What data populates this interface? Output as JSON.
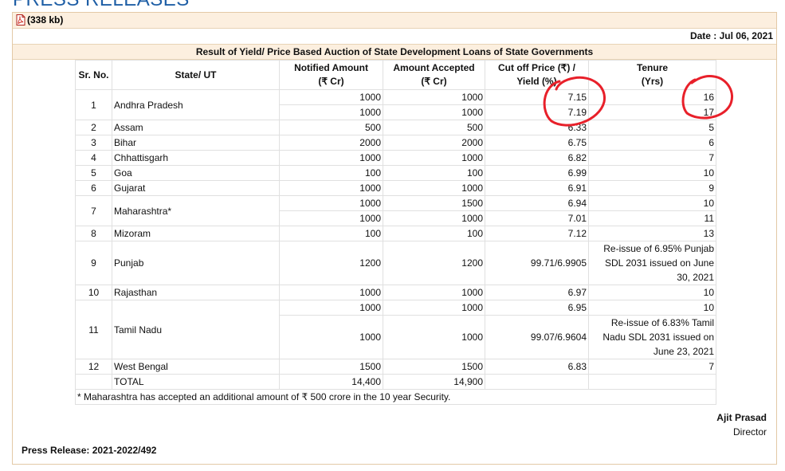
{
  "page": {
    "heading": "PRESS RELEASES"
  },
  "file": {
    "size_label": "(338 kb)",
    "icon": "pdf-icon"
  },
  "release": {
    "date": "Date : Jul 06, 2021",
    "title": "Result of Yield/ Price Based Auction of State Development Loans of State Governments",
    "press_release_no": "Press Release: 2021-2022/492",
    "signatory_name": "Ajit Prasad",
    "signatory_title": "Director",
    "footnote": "* Maharashtra has accepted an additional amount of ₹ 500 crore in the 10 year Security."
  },
  "table": {
    "headers": {
      "sr": "Sr. No.",
      "state": "State/ UT",
      "notified_1": "Notified Amount",
      "notified_2": "(₹ Cr)",
      "accepted_1": "Amount Accepted",
      "accepted_2": "(₹ Cr)",
      "cutoff_1": "Cut off Price (₹) /",
      "cutoff_2": "Yield (%)",
      "tenure_1": "Tenure",
      "tenure_2": "(Yrs)"
    },
    "rows": [
      {
        "sr": "1",
        "state": "Andhra Pradesh",
        "notified": "1000",
        "accepted": "1000",
        "cutoff": "7.15",
        "tenure": "16"
      },
      {
        "notified": "1000",
        "accepted": "1000",
        "cutoff": "7.19",
        "tenure": "17"
      },
      {
        "sr": "2",
        "state": "Assam",
        "notified": "500",
        "accepted": "500",
        "cutoff": "6.33",
        "tenure": "5"
      },
      {
        "sr": "3",
        "state": "Bihar",
        "notified": "2000",
        "accepted": "2000",
        "cutoff": "6.75",
        "tenure": "6"
      },
      {
        "sr": "4",
        "state": "Chhattisgarh",
        "notified": "1000",
        "accepted": "1000",
        "cutoff": "6.82",
        "tenure": "7"
      },
      {
        "sr": "5",
        "state": "Goa",
        "notified": "100",
        "accepted": "100",
        "cutoff": "6.99",
        "tenure": "10"
      },
      {
        "sr": "6",
        "state": "Gujarat",
        "notified": "1000",
        "accepted": "1000",
        "cutoff": "6.91",
        "tenure": "9"
      },
      {
        "sr": "7",
        "state": "Maharashtra*",
        "notified": "1000",
        "accepted": "1500",
        "cutoff": "6.94",
        "tenure": "10"
      },
      {
        "notified": "1000",
        "accepted": "1000",
        "cutoff": "7.01",
        "tenure": "11"
      },
      {
        "sr": "8",
        "state": "Mizoram",
        "notified": "100",
        "accepted": "100",
        "cutoff": "7.12",
        "tenure": "13"
      },
      {
        "sr": "9",
        "state": "Punjab",
        "notified": "1200",
        "accepted": "1200",
        "cutoff": "99.71/6.9905",
        "tenure_1": "Re-issue of 6.95% Punjab",
        "tenure_2": "SDL 2031 issued on June",
        "tenure_3": "30, 2021"
      },
      {
        "sr": "10",
        "state": "Rajasthan",
        "notified": "1000",
        "accepted": "1000",
        "cutoff": "6.97",
        "tenure": "10"
      },
      {
        "sr": "11",
        "state": "Tamil Nadu",
        "notified": "1000",
        "accepted": "1000",
        "cutoff": "6.95",
        "tenure": "10"
      },
      {
        "notified": "1000",
        "accepted": "1000",
        "cutoff": "99.07/6.9604",
        "tenure_1": "Re-issue of 6.83% Tamil",
        "tenure_2": "Nadu SDL 2031 issued on",
        "tenure_3": "June 23, 2021"
      },
      {
        "sr": "12",
        "state": "West Bengal",
        "notified": "1500",
        "accepted": "1500",
        "cutoff": "6.83",
        "tenure": "7"
      }
    ],
    "total": {
      "label": "TOTAL",
      "notified": "14,400",
      "accepted": "14,900"
    }
  },
  "annotation": {
    "color": "#e8202a"
  }
}
